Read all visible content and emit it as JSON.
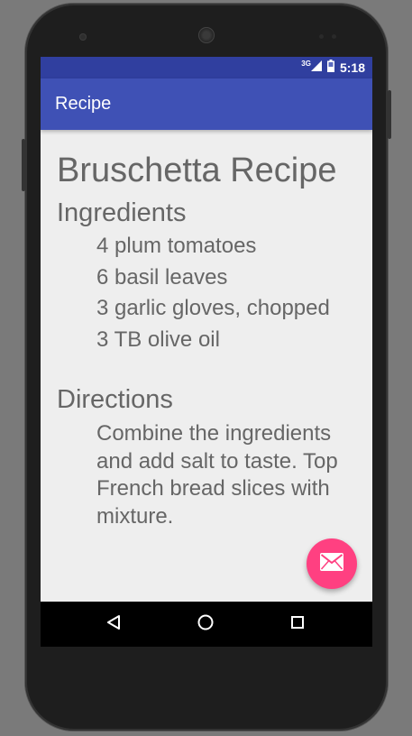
{
  "status_bar": {
    "network_type": "3G",
    "time": "5:18",
    "icons": [
      "signal-icon",
      "battery-icon"
    ]
  },
  "app_bar": {
    "title": "Recipe"
  },
  "recipe": {
    "title": "Bruschetta Recipe",
    "ingredients_heading": "Ingredients",
    "ingredients": [
      "4 plum tomatoes",
      "6 basil leaves",
      "3 garlic gloves, chopped",
      "3 TB olive oil"
    ],
    "directions_heading": "Directions",
    "directions": "Combine the ingredients and add salt to taste. Top French bread slices with mixture."
  },
  "fab": {
    "icon": "email-icon"
  },
  "nav_bar": {
    "icons": [
      "back-icon",
      "home-icon",
      "recents-icon"
    ]
  },
  "colors": {
    "status_bar": "#303f9f",
    "app_bar": "#3f51b5",
    "accent": "#ff4081",
    "text": "#666666",
    "background": "#eeeeee"
  }
}
